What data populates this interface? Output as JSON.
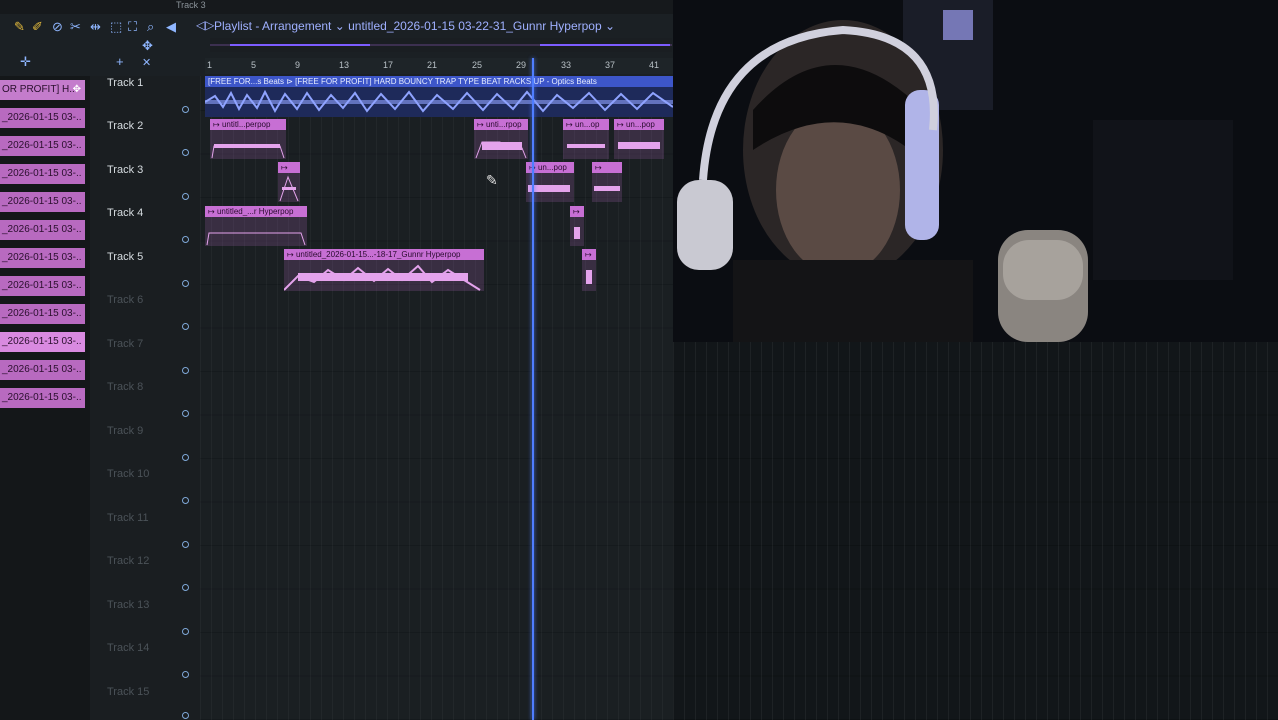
{
  "top": {
    "track_label": "Track 3"
  },
  "playlist": {
    "title": "Playlist - Arrangement",
    "project": "untitled_2026-01-15 03-22-31_Gunnr Hyperpop"
  },
  "ruler": [
    "1",
    "5",
    "9",
    "13",
    "17",
    "21",
    "25",
    "29",
    "33",
    "37",
    "41"
  ],
  "picker": {
    "items": [
      "OR PROFIT] H..",
      "_2026-01-15 03-..",
      "_2026-01-15 03-..",
      "_2026-01-15 03-..",
      "_2026-01-15 03-..",
      "_2026-01-15 03-..",
      "_2026-01-15 03-..",
      "_2026-01-15 03-..",
      "_2026-01-15 03-..",
      "_2026-01-15 03-..",
      "_2026-01-15 03-..",
      "_2026-01-15 03-.."
    ]
  },
  "tracks": [
    "Track 1",
    "Track 2",
    "Track 3",
    "Track 4",
    "Track 5",
    "Track 6",
    "Track 7",
    "Track 8",
    "Track 9",
    "Track 10",
    "Track 11",
    "Track 12",
    "Track 13",
    "Track 14",
    "Track 15"
  ],
  "clips": {
    "track1": "[FREE FOR...s Beats ⊳ [FREE FOR PROFIT] HARD BOUNCY TRAP TYPE BEAT RACKS UP - Optics Beats",
    "t2a": "untitl...perpop",
    "t2b": "unti...rpop",
    "t2c": "un...op",
    "t2d": "un...pop",
    "t3a": "",
    "t3b": "un...pop",
    "t3c": "",
    "t4a": "untitled_...r Hyperpop",
    "t4b": "",
    "t5a": "untitled_2026-01-15...-18-17_Gunnr Hyperpop",
    "t5b": ""
  },
  "colors": {
    "clip": "#c76fd4",
    "audio": "#3d56c9",
    "playhead": "#4f7dff"
  }
}
